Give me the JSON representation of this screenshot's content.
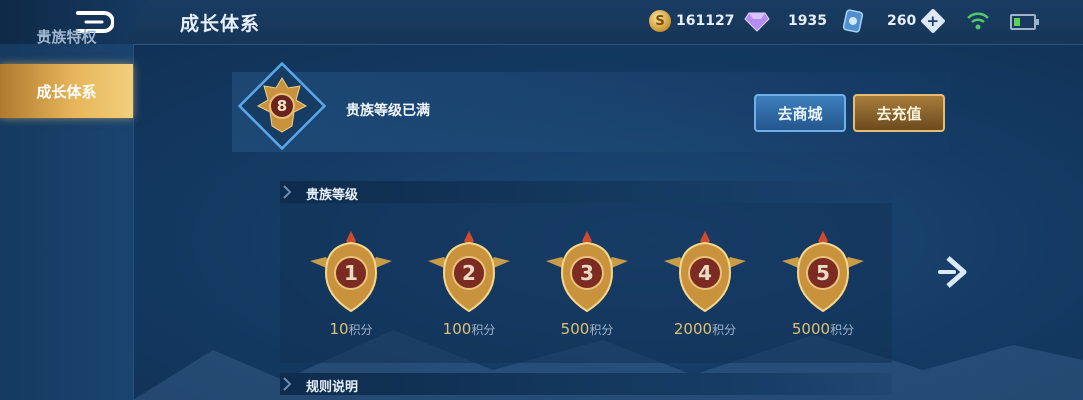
{
  "header": {
    "title": "成长体系",
    "coins": "161127",
    "gems": "1935",
    "vouchers": "260",
    "coin_symbol": "S"
  },
  "sidebar": {
    "items": [
      {
        "label": "贵族特权",
        "active": false
      },
      {
        "label": "成长体系",
        "active": true
      }
    ]
  },
  "level": {
    "badge_number": "8",
    "status": "贵族等级已满"
  },
  "buttons": {
    "shop": "去商城",
    "recharge": "去充值"
  },
  "sections": {
    "noble_level": "贵族等级",
    "rules": "规则说明"
  },
  "ranks": [
    {
      "num": "1",
      "points": "10",
      "unit": "积分"
    },
    {
      "num": "2",
      "points": "100",
      "unit": "积分"
    },
    {
      "num": "3",
      "points": "500",
      "unit": "积分"
    },
    {
      "num": "4",
      "points": "2000",
      "unit": "积分"
    },
    {
      "num": "5",
      "points": "5000",
      "unit": "积分"
    }
  ],
  "colors": {
    "accent_gold": "#e1c06f",
    "button_blue": "#3d7fbd",
    "background": "#143a63"
  },
  "icons": [
    "back-icon",
    "coin-icon",
    "gem-icon",
    "voucher-icon",
    "plus-icon",
    "wifi-icon",
    "battery-icon",
    "noble-badge-icon",
    "next-arrow-icon"
  ]
}
